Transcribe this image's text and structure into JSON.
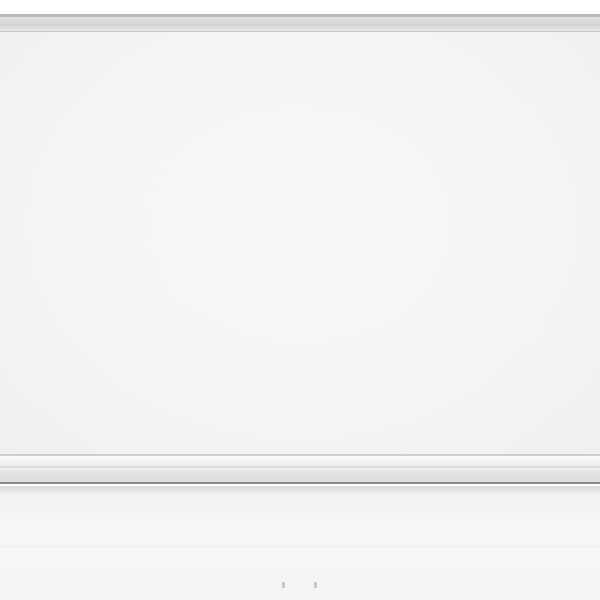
{
  "scene": {
    "subject": "whiteboard",
    "colors": {
      "background": "#ffffff",
      "surface": "#f4f4f4",
      "frame": "#b9b9b9",
      "tray_edge": "#8a8a8a"
    }
  }
}
